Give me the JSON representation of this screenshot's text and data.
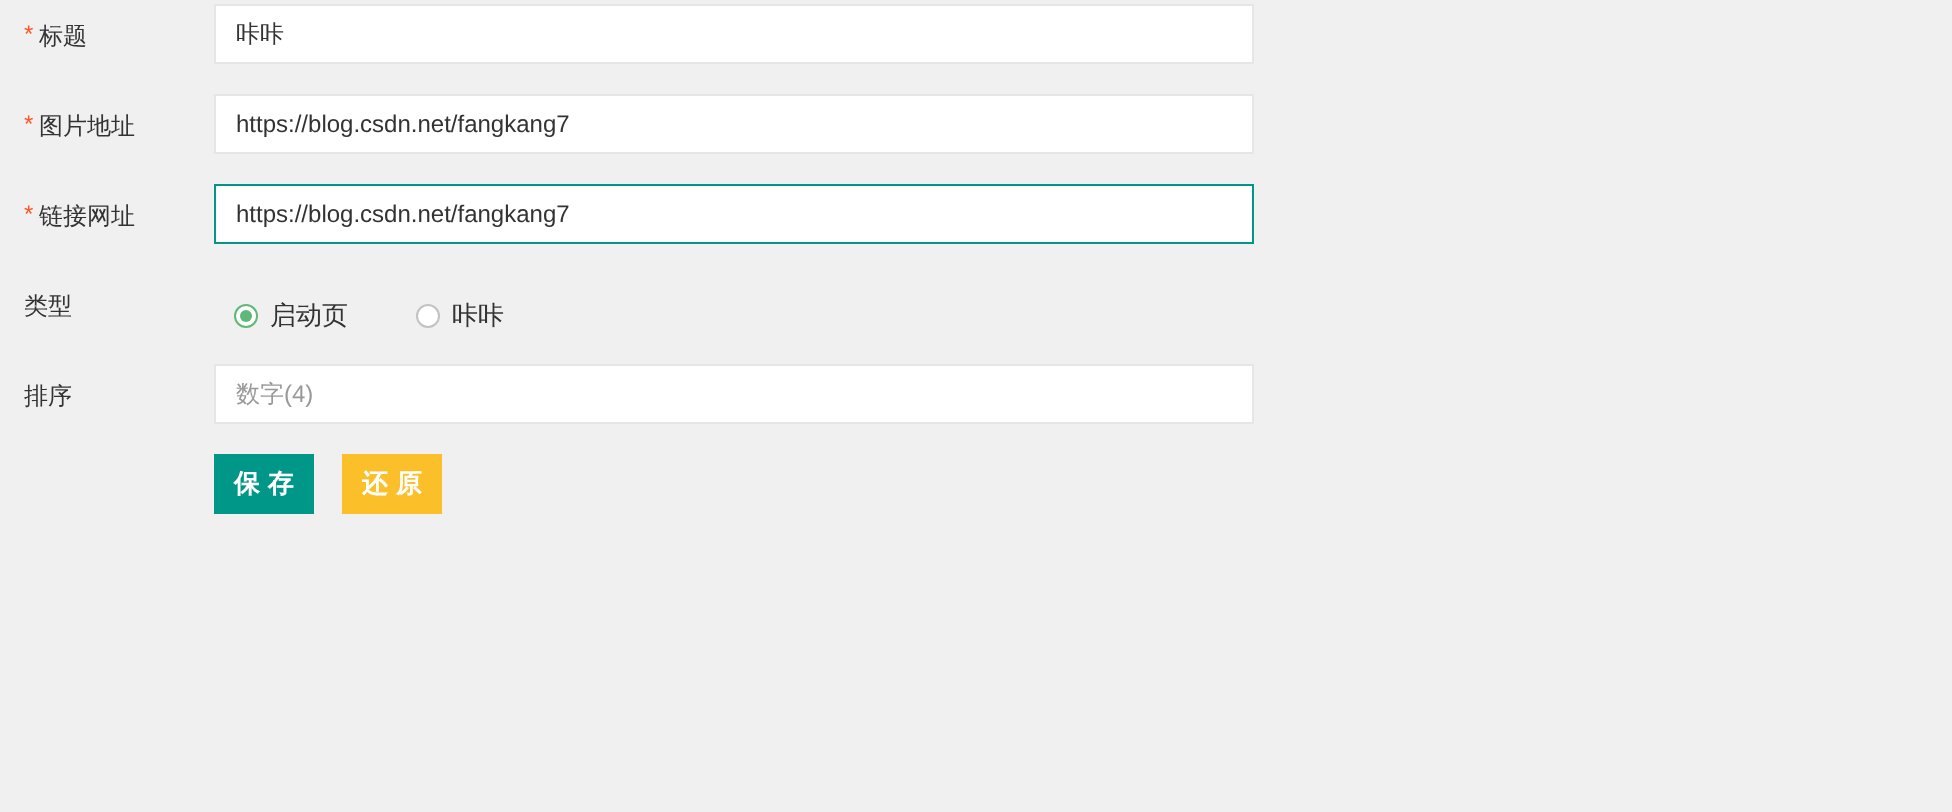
{
  "fields": [
    {
      "kind": "text",
      "mark": "*",
      "label": "标题",
      "value": "咔咔",
      "focused": false
    },
    {
      "kind": "text",
      "mark": "*",
      "label": "图片地址",
      "value": "https://blog.csdn.net/fangkang7",
      "focused": false
    },
    {
      "kind": "text",
      "mark": "*",
      "label": "链接网址",
      "value": "https://blog.csdn.net/fangkang7",
      "focused": true
    },
    {
      "kind": "radio",
      "label": "类型",
      "options": [
        {
          "label": "启动页",
          "selected": true
        },
        {
          "label": "咔咔",
          "selected": false
        }
      ]
    },
    {
      "kind": "text",
      "label": "排序",
      "placeholder": "数字(4)",
      "focused": false
    }
  ],
  "buttons": [
    {
      "label": "保存",
      "kind": "primary"
    },
    {
      "label": "还原",
      "kind": "warm"
    }
  ]
}
